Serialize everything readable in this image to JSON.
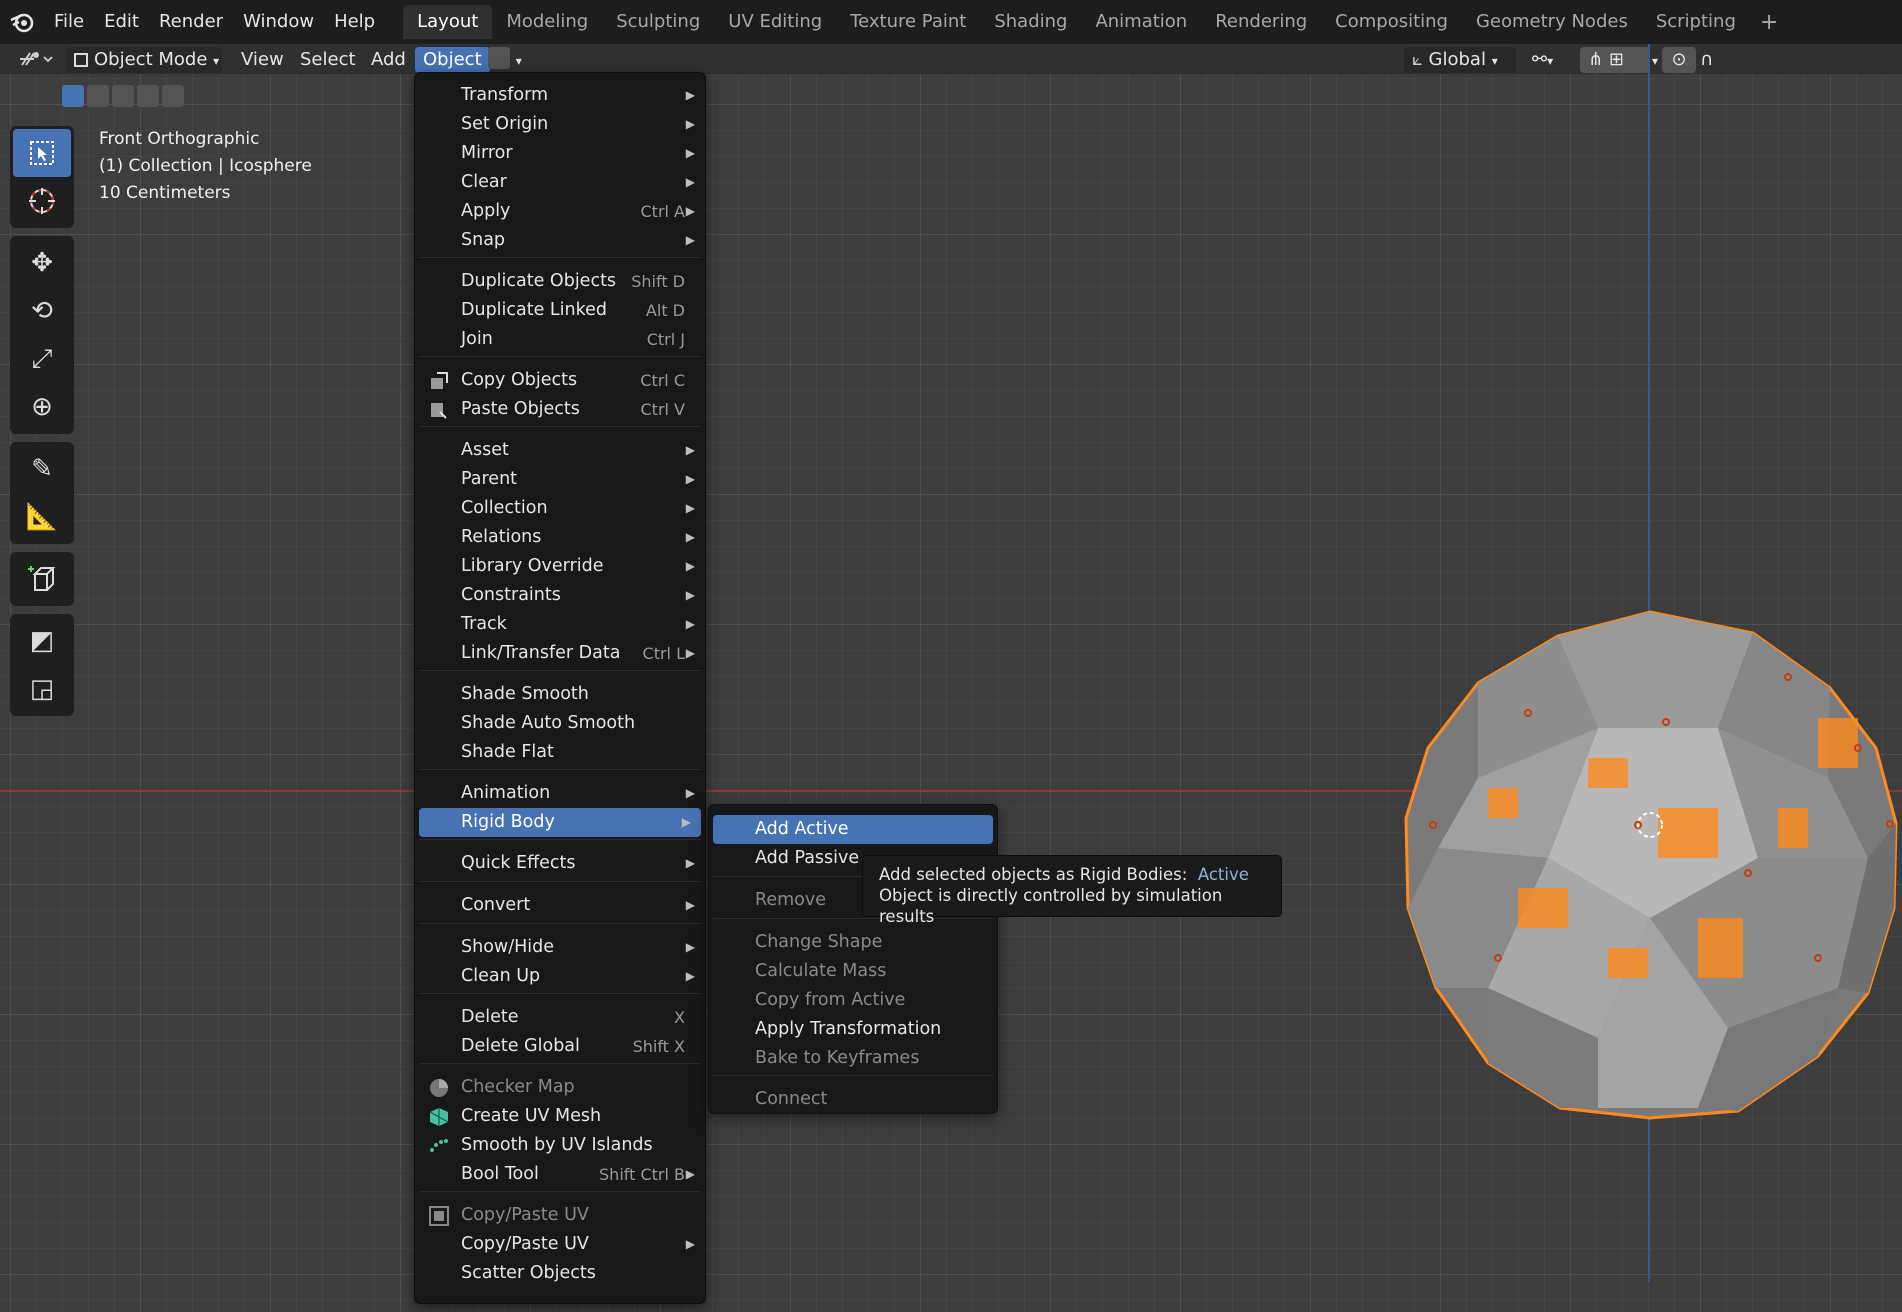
{
  "topbar": {
    "menus": [
      "File",
      "Edit",
      "Render",
      "Window",
      "Help"
    ],
    "workspaces": [
      "Layout",
      "Modeling",
      "Sculpting",
      "UV Editing",
      "Texture Paint",
      "Shading",
      "Animation",
      "Rendering",
      "Compositing",
      "Geometry Nodes",
      "Scripting"
    ],
    "active_workspace": "Layout",
    "add_tab": "+"
  },
  "header": {
    "mode": "Object Mode",
    "view": "View",
    "select": "Select",
    "add": "Add",
    "object": "Object",
    "transform_orientation": "Global"
  },
  "viewport": {
    "view_name": "Front Orthographic",
    "collection_info": "(1) Collection | Icosphere",
    "scale": "10 Centimeters"
  },
  "object_menu": {
    "items": [
      {
        "label": "Transform",
        "submenu": true
      },
      {
        "label": "Set Origin",
        "submenu": true
      },
      {
        "label": "Mirror",
        "submenu": true
      },
      {
        "label": "Clear",
        "submenu": true
      },
      {
        "label": "Apply",
        "shortcut": "Ctrl A",
        "submenu": true
      },
      {
        "label": "Snap",
        "submenu": true
      },
      {
        "label": "Duplicate Objects",
        "shortcut": "Shift D"
      },
      {
        "label": "Duplicate Linked",
        "shortcut": "Alt D"
      },
      {
        "label": "Join",
        "shortcut": "Ctrl J"
      },
      {
        "label": "Copy Objects",
        "shortcut": "Ctrl C",
        "icon": "copy-icon"
      },
      {
        "label": "Paste Objects",
        "shortcut": "Ctrl V",
        "icon": "paste-icon"
      },
      {
        "label": "Asset",
        "submenu": true
      },
      {
        "label": "Parent",
        "submenu": true
      },
      {
        "label": "Collection",
        "submenu": true
      },
      {
        "label": "Relations",
        "submenu": true
      },
      {
        "label": "Library Override",
        "submenu": true
      },
      {
        "label": "Constraints",
        "submenu": true
      },
      {
        "label": "Track",
        "submenu": true
      },
      {
        "label": "Link/Transfer Data",
        "shortcut": "Ctrl L",
        "submenu": true
      },
      {
        "label": "Shade Smooth"
      },
      {
        "label": "Shade Auto Smooth"
      },
      {
        "label": "Shade Flat"
      },
      {
        "label": "Animation",
        "submenu": true
      },
      {
        "label": "Rigid Body",
        "submenu": true,
        "highlighted": true
      },
      {
        "label": "Quick Effects",
        "submenu": true
      },
      {
        "label": "Convert",
        "submenu": true
      },
      {
        "label": "Show/Hide",
        "submenu": true
      },
      {
        "label": "Clean Up",
        "submenu": true
      },
      {
        "label": "Delete",
        "shortcut": "X"
      },
      {
        "label": "Delete Global",
        "shortcut": "Shift X"
      },
      {
        "label": "Checker Map",
        "disabled": true,
        "icon": "checker-icon"
      },
      {
        "label": "Create UV Mesh",
        "icon": "uv-mesh-icon"
      },
      {
        "label": "Smooth by UV Islands",
        "icon": "uv-islands-icon"
      },
      {
        "label": "Bool Tool",
        "shortcut": "Shift Ctrl B",
        "submenu": true
      },
      {
        "label": "Copy/Paste UV",
        "disabled": true,
        "icon": "copy-paste-uv-icon"
      },
      {
        "label": "Copy/Paste UV",
        "submenu": true
      },
      {
        "label": "Scatter Objects"
      }
    ]
  },
  "rigid_body_menu": {
    "items": [
      {
        "label": "Add Active",
        "highlighted": true
      },
      {
        "label": "Add Passive"
      },
      {
        "label": "Remove",
        "disabled": true
      },
      {
        "label": "Change Shape",
        "disabled": true
      },
      {
        "label": "Calculate Mass",
        "disabled": true
      },
      {
        "label": "Copy from Active",
        "disabled": true
      },
      {
        "label": "Apply Transformation"
      },
      {
        "label": "Bake to Keyframes",
        "disabled": true
      },
      {
        "label": "Connect",
        "disabled": true
      }
    ]
  },
  "tooltip": {
    "line1": "Add selected objects as Rigid Bodies:",
    "line1_accent": "Active",
    "line2": "Object is directly controlled by simulation results"
  },
  "colors": {
    "accent": "#4772b3",
    "selection_orange": "#ff8a1e",
    "axis_x": "#8a3a3a",
    "axis_y": "#3a5a8a"
  }
}
